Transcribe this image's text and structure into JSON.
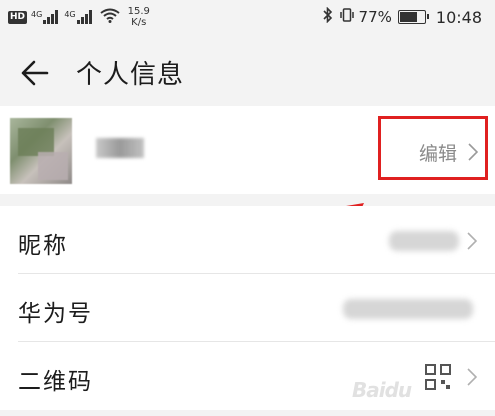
{
  "status_bar": {
    "hd_label": "HD",
    "sim1_label": "4G",
    "sim2_label": "4G",
    "net_speed_value": "15.9",
    "net_speed_unit": "K/s",
    "battery_percent": "77%",
    "battery_level": 0.77,
    "time": "10:48"
  },
  "header": {
    "title": "个人信息"
  },
  "profile": {
    "edit_label": "编辑"
  },
  "rows": [
    {
      "label": "昵称"
    },
    {
      "label": "华为号"
    },
    {
      "label": "二维码"
    }
  ],
  "watermark": "Baidu",
  "colors": {
    "highlight": "#e02020",
    "background": "#f3f3f3",
    "card": "#ffffff"
  },
  "icons": [
    "back-arrow-icon",
    "bluetooth-icon",
    "vibrate-icon",
    "battery-icon",
    "wifi-icon",
    "chevron-right-icon",
    "qr-code-icon"
  ]
}
